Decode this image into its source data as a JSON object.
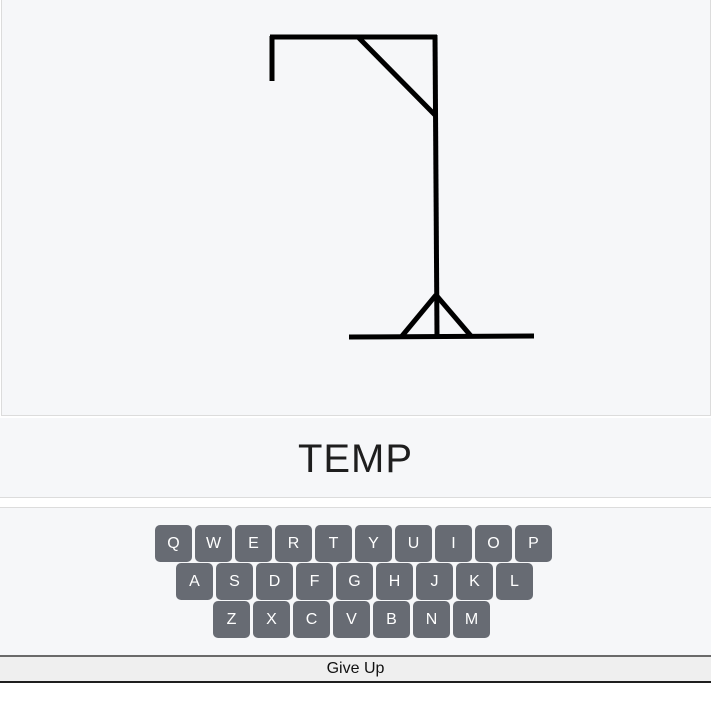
{
  "game": {
    "word": "TEMP"
  },
  "colors": {
    "panel_bg": "#f6f7f9",
    "key_bg": "#676b73",
    "key_text": "#ffffff",
    "gallows_stroke": "#000000"
  },
  "keyboard": {
    "row1": [
      "Q",
      "W",
      "E",
      "R",
      "T",
      "Y",
      "U",
      "I",
      "O",
      "P"
    ],
    "row2": [
      "A",
      "S",
      "D",
      "F",
      "G",
      "H",
      "J",
      "K",
      "L"
    ],
    "row3": [
      "Z",
      "X",
      "C",
      "V",
      "B",
      "N",
      "M"
    ]
  },
  "actions": {
    "give_up_label": "Give Up"
  }
}
